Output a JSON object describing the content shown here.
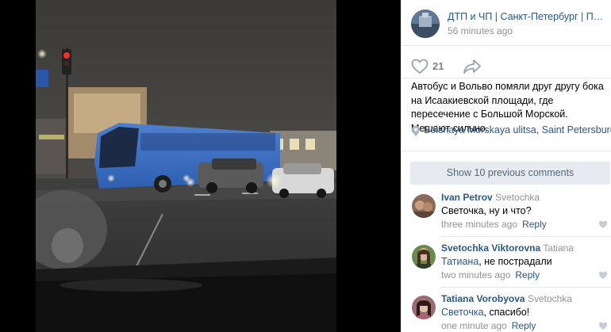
{
  "post": {
    "author": "ДТП и ЧП | Санкт-Петербург | Питер Онлайн",
    "time": "56 minutes ago",
    "likes": "21",
    "text": "Автобус и Вольво помяли друг другу бока на Исаакиевской площади, где пересечение с Большой Морской. Мешают сильно.",
    "location": "Bolshaya Morskaya ulitsa, Saint Petersburg",
    "show_prev_label": "Show 10 previous comments"
  },
  "comments": [
    {
      "author": "Ivan Petrov",
      "reply_to": "Svetochka",
      "addressee": "",
      "text": "Светочка, ну и что?",
      "time": "three minutes ago",
      "reply_label": "Reply"
    },
    {
      "author": "Svetochka Viktorovna",
      "reply_to": "Tatiana",
      "addressee": "Татиана",
      "text": ", не пострадали",
      "time": "two minutes ago",
      "reply_label": "Reply"
    },
    {
      "author": "Tatiana Vorobyova",
      "reply_to": "Svetochka",
      "addressee": "Светочка",
      "text": ", спасибо!",
      "time": "one minute ago",
      "reply_label": "Reply"
    }
  ],
  "icons": {
    "like": "heart-icon",
    "share": "share-arrow-icon",
    "location": "map-pin-icon",
    "comment_like": "small-heart-icon"
  },
  "colors": {
    "link": "#2a5885",
    "muted": "#939393",
    "button_bg": "#e5ebf1",
    "button_text": "#55677d",
    "separator": "#e7e8ec"
  }
}
